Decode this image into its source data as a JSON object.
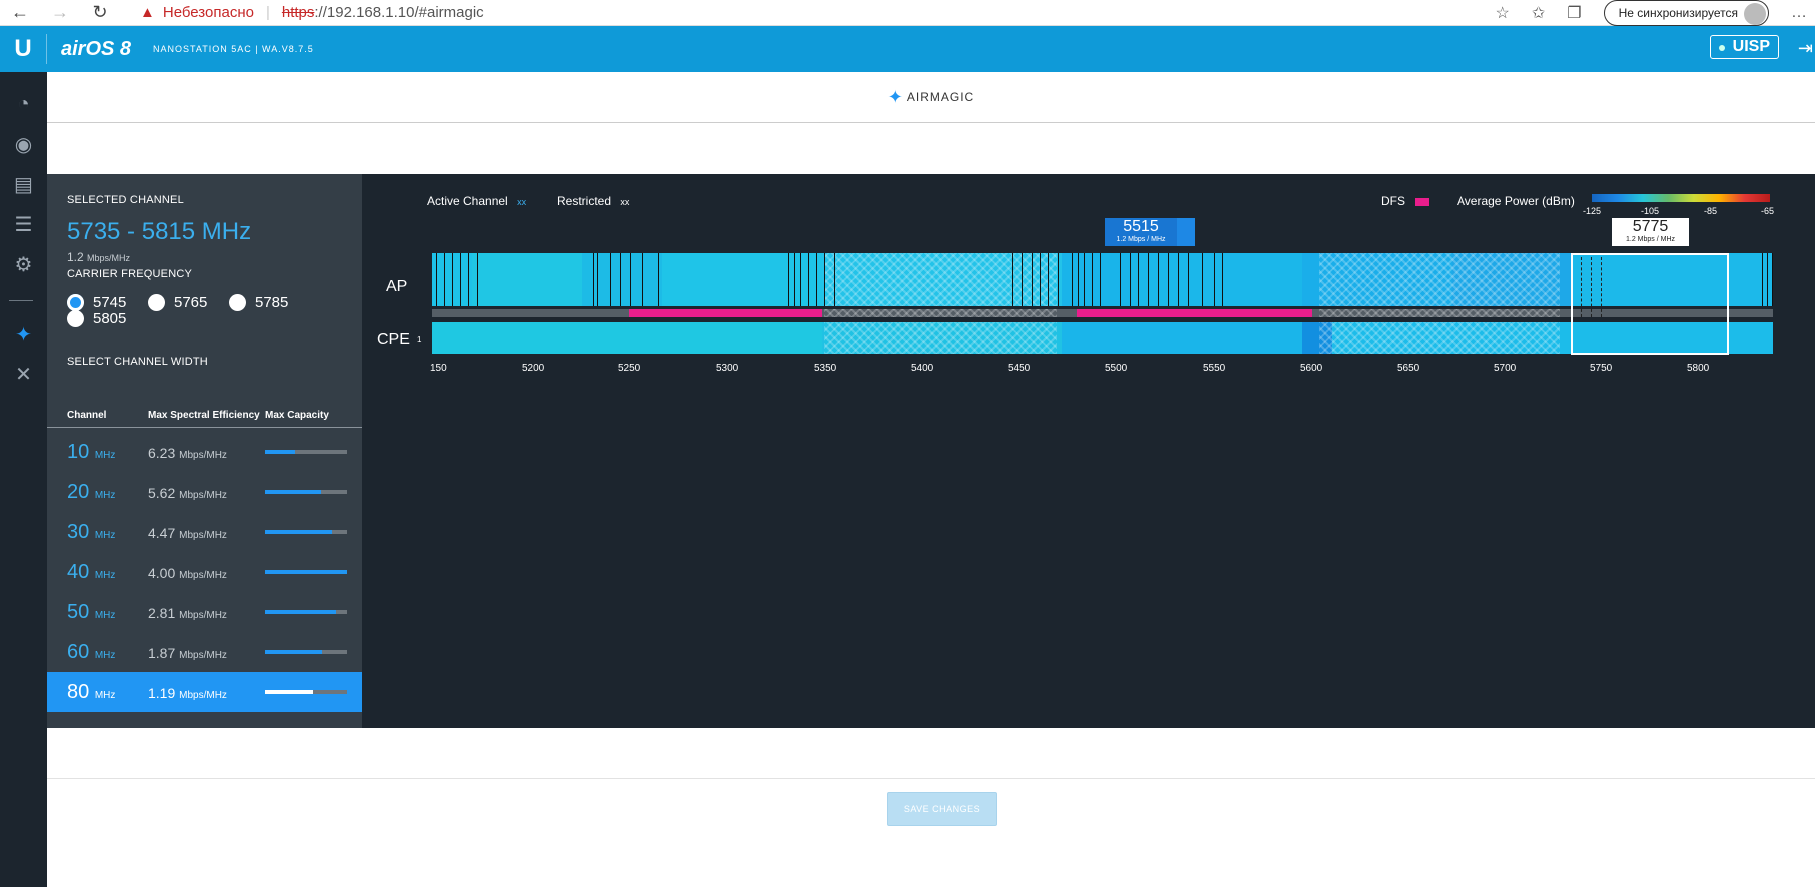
{
  "browser": {
    "insecure_label": "Небезопасно",
    "url_https": "https",
    "url_rest": "://192.168.1.10/#airmagic",
    "sync_label": "Не синхронизируется"
  },
  "header": {
    "brand": "airOS 8",
    "device_model": "NANOSTATION 5AC | WA.V8.7.5",
    "uisp_label": "UISP"
  },
  "page": {
    "title": "AIRMAGIC"
  },
  "left": {
    "selected_channel_label": "SELECTED CHANNEL",
    "selected_freq": "5735 - 5815 MHz",
    "selected_eff_value": "1.2",
    "selected_eff_unit": "Mbps/MHz",
    "carrier_label": "CARRIER FREQUENCY",
    "carrier_options": [
      "5745",
      "5765",
      "5785",
      "5805"
    ],
    "carrier_selected": "5745",
    "width_label": "SELECT CHANNEL WIDTH",
    "col_channel": "Channel",
    "col_eff": "Max Spectral Efficiency",
    "col_cap": "Max Capacity",
    "rows": [
      {
        "width": "10",
        "unit": "MHz",
        "eff": "6.23",
        "eff_unit": "Mbps/MHz",
        "capacity": 0.37
      },
      {
        "width": "20",
        "unit": "MHz",
        "eff": "5.62",
        "eff_unit": "Mbps/MHz",
        "capacity": 0.68
      },
      {
        "width": "30",
        "unit": "MHz",
        "eff": "4.47",
        "eff_unit": "Mbps/MHz",
        "capacity": 0.82
      },
      {
        "width": "40",
        "unit": "MHz",
        "eff": "4.00",
        "eff_unit": "Mbps/MHz",
        "capacity": 1.0
      },
      {
        "width": "50",
        "unit": "MHz",
        "eff": "2.81",
        "eff_unit": "Mbps/MHz",
        "capacity": 0.87
      },
      {
        "width": "60",
        "unit": "MHz",
        "eff": "1.87",
        "eff_unit": "Mbps/MHz",
        "capacity": 0.7
      },
      {
        "width": "80",
        "unit": "MHz",
        "eff": "1.19",
        "eff_unit": "Mbps/MHz",
        "capacity": 0.59
      }
    ],
    "selected_width": "80"
  },
  "spectrum": {
    "legend_active": "Active Channel",
    "legend_restricted": "Restricted",
    "legend_x": "xx",
    "legend_dfs": "DFS",
    "legend_power": "Average Power (dBm)",
    "power_ticks": [
      "-125",
      "-105",
      "-85",
      "-65"
    ],
    "ap_label": "AP",
    "cpe_label": "CPE",
    "cpe_count": "1",
    "freq_ticks": [
      "150",
      "5200",
      "5250",
      "5300",
      "5350",
      "5400",
      "5450",
      "5500",
      "5550",
      "5600",
      "5650",
      "5700",
      "5750",
      "5800"
    ],
    "marker_a": {
      "freq": "5515",
      "eff": "1.2 Mbps / MHz"
    },
    "marker_b": {
      "freq": "5775",
      "eff": "1.2 Mbps / MHz"
    }
  },
  "footer": {
    "save_label": "SAVE CHANGES"
  }
}
